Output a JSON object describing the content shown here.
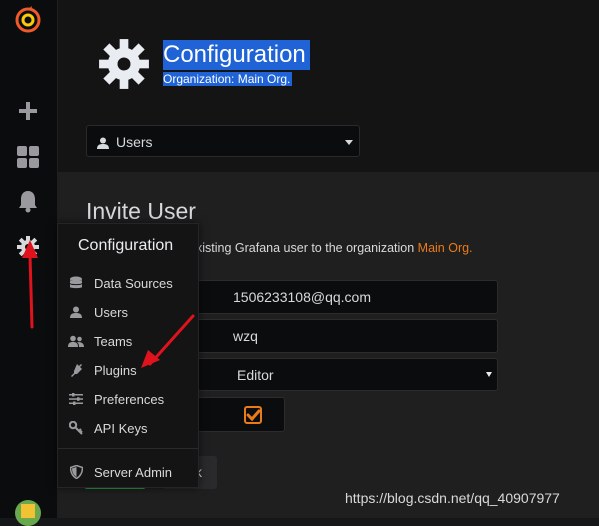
{
  "page": {
    "title": "Configuration",
    "subtitle": "Organization: Main Org."
  },
  "nav_select": {
    "label": "Users",
    "icon": "user-icon"
  },
  "invite": {
    "title": "Invite User",
    "desc_prefix": "xisting Grafana user to the organization ",
    "desc_org": "Main Org.",
    "email_value": "1506233108@qq.com",
    "name_value": "wzq",
    "role_value": "Editor",
    "send_email_checked": true,
    "back_label": "k"
  },
  "dropdown": {
    "header": "Configuration",
    "items": [
      {
        "label": "Data Sources",
        "icon": "database-icon"
      },
      {
        "label": "Users",
        "icon": "user-icon"
      },
      {
        "label": "Teams",
        "icon": "users-icon"
      },
      {
        "label": "Plugins",
        "icon": "plug-icon"
      },
      {
        "label": "Preferences",
        "icon": "sliders-icon"
      },
      {
        "label": "API Keys",
        "icon": "key-icon"
      },
      {
        "label": "Server Admin",
        "icon": "shield-icon"
      }
    ]
  },
  "sidemenu": {
    "icons": [
      "grafana-logo-icon",
      "plus-icon",
      "dashboards-icon",
      "bell-icon",
      "gear-icon",
      "avatar"
    ]
  },
  "watermark": "https://blog.csdn.net/qq_40907977",
  "colors": {
    "accent": "#eb7b18",
    "selection": "#1f63d6",
    "annotation_arrow": "#e0131d"
  }
}
